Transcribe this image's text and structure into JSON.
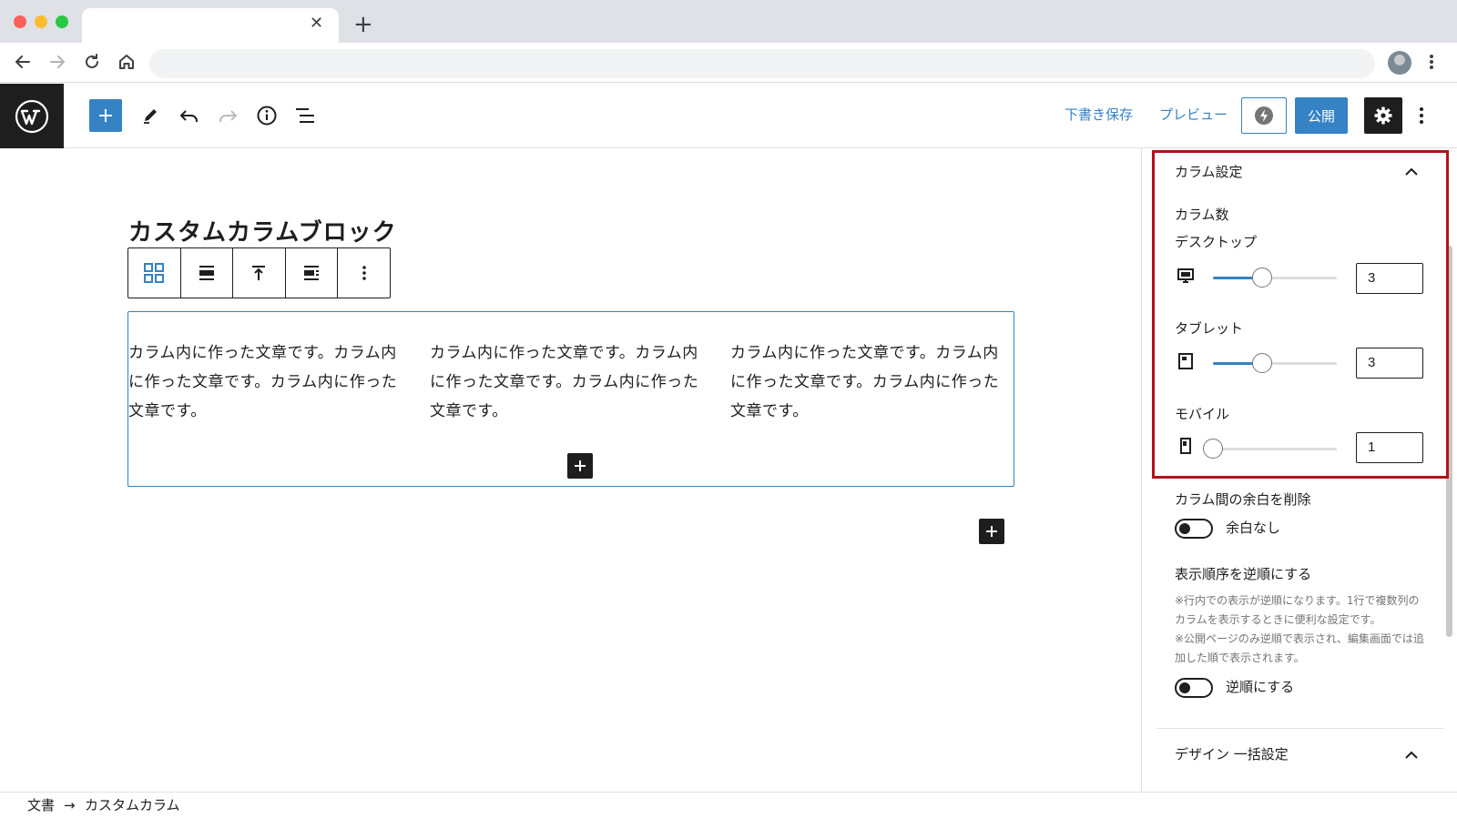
{
  "browser": {
    "tab_close": "✕",
    "tab_new": "+"
  },
  "header": {
    "save_draft": "下書き保存",
    "preview": "プレビュー",
    "publish": "公開"
  },
  "post": {
    "title": "カスタムカラムブロック",
    "columns": [
      "カラム内に作った文章です。カラム内に作った文章です。カラム内に作った文章です。",
      "カラム内に作った文章です。カラム内に作った文章です。カラム内に作った文章です。",
      "カラム内に作った文章です。カラム内に作った文章です。カラム内に作った文章です。"
    ]
  },
  "sidebar": {
    "panel_title": "カラム設定",
    "column_count_label": "カラム数",
    "devices": [
      {
        "label": "デスクトップ",
        "icon": "desktop-icon",
        "value": "3",
        "level": 0.4
      },
      {
        "label": "タブレット",
        "icon": "tablet-icon",
        "value": "3",
        "level": 0.4
      },
      {
        "label": "モバイル",
        "icon": "mobile-icon",
        "value": "1",
        "level": 0.0
      }
    ],
    "gap_title": "カラム間の余白を削除",
    "gap_toggle_label": "余白なし",
    "reverse_title": "表示順序を逆順にする",
    "reverse_note1": "※行内での表示が逆順になります。1行で複数列のカラムを表示するときに便利な設定です。",
    "reverse_note2": "※公開ページのみ逆順で表示され、編集画面では追加した順で表示されます。",
    "reverse_toggle_label": "逆順にする",
    "design_title": "デザイン 一括設定"
  },
  "footer": {
    "crumb_root": "文書",
    "crumb_arrow": "→",
    "crumb_current": "カスタムカラム"
  },
  "colors": {
    "accent": "#3582c4",
    "dark": "#1e1e1e",
    "highlight": "#b3111c"
  }
}
